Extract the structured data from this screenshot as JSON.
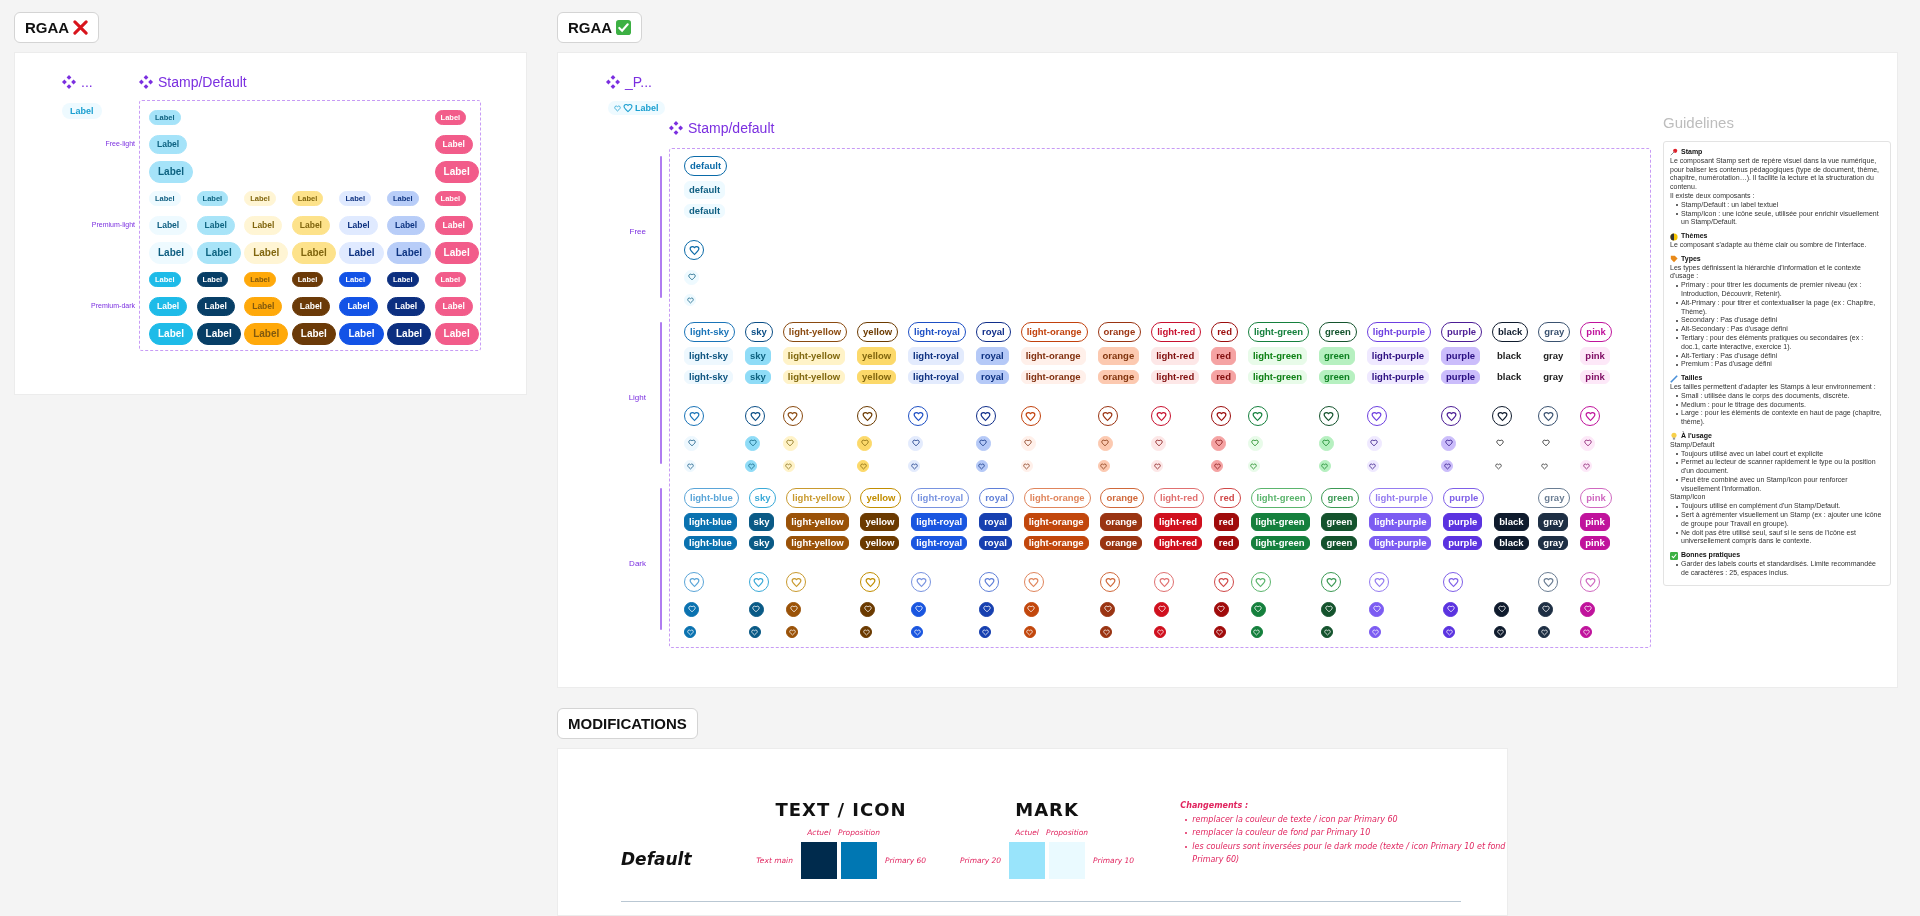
{
  "left": {
    "chip": {
      "text": "RGAA",
      "compliant": false
    },
    "component": {
      "name": "...",
      "pill": "Label"
    },
    "title": "Stamp/Default",
    "groups": [
      {
        "label": "Free-light",
        "rows": [
          {
            "kind": "small",
            "items": [
              {
                "text": "Label",
                "color": "#a5e3f9"
              },
              {
                "text": "Label",
                "color": "#f25c8a"
              }
            ]
          },
          {
            "kind": "medium",
            "items": [
              {
                "text": "Label",
                "color": "#a5e3f9"
              },
              {
                "text": "Label",
                "color": "#f25c8a"
              }
            ]
          },
          {
            "kind": "large",
            "items": [
              {
                "text": "Label",
                "color": "#a5e3f9"
              },
              {
                "text": "Label",
                "color": "#f25c8a"
              }
            ]
          }
        ]
      },
      {
        "label": "Premium-light",
        "rows": [
          {
            "kind": "small",
            "items": [
              {
                "text": "Label",
                "color": "#eefaff"
              },
              {
                "text": "Label",
                "color": "#a8e4f8"
              },
              {
                "text": "Label",
                "color": "#fff5d4"
              },
              {
                "text": "Label",
                "color": "#fde28a"
              },
              {
                "text": "Label",
                "color": "#e0eaff"
              },
              {
                "text": "Label",
                "color": "#b8cdf8"
              },
              {
                "text": "Label",
                "color": "#f25c8a"
              }
            ]
          },
          {
            "kind": "medium",
            "items": [
              {
                "text": "Label",
                "color": "#eefaff"
              },
              {
                "text": "Label",
                "color": "#a8e4f8"
              },
              {
                "text": "Label",
                "color": "#fff5d4"
              },
              {
                "text": "Label",
                "color": "#fde28a"
              },
              {
                "text": "Label",
                "color": "#e0eaff"
              },
              {
                "text": "Label",
                "color": "#b8cdf8"
              },
              {
                "text": "Label",
                "color": "#f25c8a"
              }
            ]
          },
          {
            "kind": "large",
            "items": [
              {
                "text": "Label",
                "color": "#eefaff"
              },
              {
                "text": "Label",
                "color": "#a8e4f8"
              },
              {
                "text": "Label",
                "color": "#fff5d4"
              },
              {
                "text": "Label",
                "color": "#fde28a"
              },
              {
                "text": "Label",
                "color": "#e0eaff"
              },
              {
                "text": "Label",
                "color": "#b8cdf8"
              },
              {
                "text": "Label",
                "color": "#f25c8a"
              }
            ]
          }
        ]
      },
      {
        "label": "Premium-dark",
        "rows": [
          {
            "kind": "small",
            "items": [
              {
                "text": "Label",
                "color": "#1ebbe8"
              },
              {
                "text": "Label",
                "color": "#073e66"
              },
              {
                "text": "Label",
                "color": "#ffa90a"
              },
              {
                "text": "Label",
                "color": "#6b3a08"
              },
              {
                "text": "Label",
                "color": "#1353e6"
              },
              {
                "text": "Label",
                "color": "#0c2f80"
              },
              {
                "text": "Label",
                "color": "#f25c8a"
              }
            ]
          },
          {
            "kind": "medium",
            "items": [
              {
                "text": "Label",
                "color": "#1ebbe8"
              },
              {
                "text": "Label",
                "color": "#073e66"
              },
              {
                "text": "Label",
                "color": "#ffa90a"
              },
              {
                "text": "Label",
                "color": "#6b3a08"
              },
              {
                "text": "Label",
                "color": "#1353e6"
              },
              {
                "text": "Label",
                "color": "#0c2f80"
              },
              {
                "text": "Label",
                "color": "#f25c8a"
              }
            ]
          },
          {
            "kind": "large",
            "items": [
              {
                "text": "Label",
                "color": "#1ebbe8"
              },
              {
                "text": "Label",
                "color": "#073e66"
              },
              {
                "text": "Label",
                "color": "#ffa90a"
              },
              {
                "text": "Label",
                "color": "#6b3a08"
              },
              {
                "text": "Label",
                "color": "#1353e6"
              },
              {
                "text": "Label",
                "color": "#0c2f80"
              },
              {
                "text": "Label",
                "color": "#f25c8a"
              }
            ]
          }
        ]
      }
    ]
  },
  "right": {
    "chip": {
      "text": "RGAA",
      "compliant": true
    },
    "component": {
      "name": "_P...",
      "pill": "Label"
    },
    "title": "Stamp/default",
    "sections": [
      {
        "label": "Free",
        "rows": [
          {
            "kind": "outlined",
            "items": [
              {
                "text": "default",
                "color": "#0a6aa8"
              }
            ]
          },
          {
            "kind": "medium",
            "items": [
              {
                "text": "default",
                "color": "#eefaff"
              }
            ]
          },
          {
            "kind": "small",
            "items": [
              {
                "text": "default",
                "color": "#eefaff"
              }
            ]
          },
          {
            "kind": "ring",
            "items": [
              {
                "color": "#0a6aa8"
              }
            ]
          },
          {
            "kind": "disc",
            "items": [
              {
                "color": "#eefaff"
              }
            ]
          },
          {
            "kind": "minidisc",
            "items": [
              {
                "color": "#eefaff"
              }
            ]
          }
        ]
      },
      {
        "label": "Light",
        "rows": [
          {
            "kind": "outlined",
            "items": [
              {
                "text": "light-sky",
                "color": "#1a74b8"
              },
              {
                "text": "sky",
                "color": "#0a4e86"
              },
              {
                "text": "light-yellow",
                "color": "#8a4a10"
              },
              {
                "text": "yellow",
                "color": "#6b3a00"
              },
              {
                "text": "light-royal",
                "color": "#1d4fc4"
              },
              {
                "text": "royal",
                "color": "#102e8a"
              },
              {
                "text": "light-orange",
                "color": "#c2410c"
              },
              {
                "text": "orange",
                "color": "#9a3412"
              },
              {
                "text": "light-red",
                "color": "#c8102e"
              },
              {
                "text": "red",
                "color": "#9b0c0c"
              },
              {
                "text": "light-green",
                "color": "#15803d"
              },
              {
                "text": "green",
                "color": "#14532d"
              },
              {
                "text": "light-purple",
                "color": "#6d3fe0"
              },
              {
                "text": "purple",
                "color": "#4c1d95"
              },
              {
                "text": "black",
                "color": "#0f1b2d"
              },
              {
                "text": "gray",
                "color": "#3a5270"
              },
              {
                "text": "pink",
                "color": "#c0139c"
              }
            ]
          },
          {
            "kind": "medium",
            "items": [
              {
                "text": "light-sky",
                "color": "#eef8fe"
              },
              {
                "text": "sky",
                "color": "#8fdcf7"
              },
              {
                "text": "light-yellow",
                "color": "#fff3c8"
              },
              {
                "text": "yellow",
                "color": "#fcd96a"
              },
              {
                "text": "light-royal",
                "color": "#e3ebfd"
              },
              {
                "text": "royal",
                "color": "#b5c9f7"
              },
              {
                "text": "light-orange",
                "color": "#fff0ea"
              },
              {
                "text": "orange",
                "color": "#fcc9b0"
              },
              {
                "text": "light-red",
                "color": "#fde7e7"
              },
              {
                "text": "red",
                "color": "#f5a3a3"
              },
              {
                "text": "light-green",
                "color": "#e8fbe9"
              },
              {
                "text": "green",
                "color": "#b6f0c0"
              },
              {
                "text": "light-purple",
                "color": "#efe9ff"
              },
              {
                "text": "purple",
                "color": "#cbbdfb"
              },
              {
                "text": "black",
                "color": "#ffffff"
              },
              {
                "text": "gray",
                "color": "#ffffff"
              },
              {
                "text": "pink",
                "color": "#fde8f8"
              }
            ]
          },
          {
            "kind": "small",
            "items": [
              {
                "text": "light-sky",
                "color": "#eef8fe"
              },
              {
                "text": "sky",
                "color": "#8fdcf7"
              },
              {
                "text": "light-yellow",
                "color": "#fff3c8"
              },
              {
                "text": "yellow",
                "color": "#fcd96a"
              },
              {
                "text": "light-royal",
                "color": "#e3ebfd"
              },
              {
                "text": "royal",
                "color": "#b5c9f7"
              },
              {
                "text": "light-orange",
                "color": "#fff0ea"
              },
              {
                "text": "orange",
                "color": "#fcc9b0"
              },
              {
                "text": "light-red",
                "color": "#fde7e7"
              },
              {
                "text": "red",
                "color": "#f5a3a3"
              },
              {
                "text": "light-green",
                "color": "#e8fbe9"
              },
              {
                "text": "green",
                "color": "#b6f0c0"
              },
              {
                "text": "light-purple",
                "color": "#efe9ff"
              },
              {
                "text": "purple",
                "color": "#cbbdfb"
              },
              {
                "text": "black",
                "color": "#ffffff"
              },
              {
                "text": "gray",
                "color": "#ffffff"
              },
              {
                "text": "pink",
                "color": "#fde8f8"
              }
            ]
          },
          {
            "kind": "ring",
            "items": [
              {
                "color": "#1a74b8"
              },
              {
                "color": "#0a4e86"
              },
              {
                "color": "#8a4a10"
              },
              {
                "color": "#6b3a00"
              },
              {
                "color": "#1d4fc4"
              },
              {
                "color": "#102e8a"
              },
              {
                "color": "#c2410c"
              },
              {
                "color": "#9a3412"
              },
              {
                "color": "#c8102e"
              },
              {
                "color": "#9b0c0c"
              },
              {
                "color": "#15803d"
              },
              {
                "color": "#14532d"
              },
              {
                "color": "#6d3fe0"
              },
              {
                "color": "#4c1d95"
              },
              {
                "color": "#0f1b2d"
              },
              {
                "color": "#3a5270"
              },
              {
                "color": "#c0139c"
              }
            ]
          },
          {
            "kind": "disc",
            "items": [
              {
                "color": "#eef8fe"
              },
              {
                "color": "#8fdcf7"
              },
              {
                "color": "#fff3c8"
              },
              {
                "color": "#fcd96a"
              },
              {
                "color": "#e3ebfd"
              },
              {
                "color": "#b5c9f7"
              },
              {
                "color": "#fff0ea"
              },
              {
                "color": "#fcc9b0"
              },
              {
                "color": "#fde7e7"
              },
              {
                "color": "#f5a3a3"
              },
              {
                "color": "#e8fbe9"
              },
              {
                "color": "#b6f0c0"
              },
              {
                "color": "#efe9ff"
              },
              {
                "color": "#cbbdfb"
              },
              {
                "color": "#ffffff"
              },
              {
                "color": "#ffffff"
              },
              {
                "color": "#fde8f8"
              }
            ]
          },
          {
            "kind": "minidisc",
            "items": [
              {
                "color": "#eef8fe"
              },
              {
                "color": "#8fdcf7"
              },
              {
                "color": "#fff3c8"
              },
              {
                "color": "#fcd96a"
              },
              {
                "color": "#e3ebfd"
              },
              {
                "color": "#b5c9f7"
              },
              {
                "color": "#fff0ea"
              },
              {
                "color": "#fcc9b0"
              },
              {
                "color": "#fde7e7"
              },
              {
                "color": "#f5a3a3"
              },
              {
                "color": "#e8fbe9"
              },
              {
                "color": "#b6f0c0"
              },
              {
                "color": "#efe9ff"
              },
              {
                "color": "#cbbdfb"
              },
              {
                "color": "#ffffff"
              },
              {
                "color": "#ffffff"
              },
              {
                "color": "#fde8f8"
              }
            ]
          }
        ]
      },
      {
        "label": "Dark",
        "rows": [
          {
            "kind": "outlined",
            "items": [
              {
                "text": "light-blue",
                "color": "#5aa5d8"
              },
              {
                "text": "sky",
                "color": "#3aaad8"
              },
              {
                "text": "light-yellow",
                "color": "#c99a2e"
              },
              {
                "text": "yellow",
                "color": "#c28e00"
              },
              {
                "text": "light-royal",
                "color": "#7893e0"
              },
              {
                "text": "royal",
                "color": "#5f7fd8"
              },
              {
                "text": "light-orange",
                "color": "#e0855c"
              },
              {
                "text": "orange",
                "color": "#d0683a"
              },
              {
                "text": "light-red",
                "color": "#e07070"
              },
              {
                "text": "red",
                "color": "#d04848"
              },
              {
                "text": "light-green",
                "color": "#5bb56d"
              },
              {
                "text": "green",
                "color": "#3c9a55"
              },
              {
                "text": "light-purple",
                "color": "#957cf0"
              },
              {
                "text": "purple",
                "color": "#7f5fe8"
              },
              {
                "text": "gray",
                "color": "#6a7d93",
                "gap_before": true
              },
              {
                "text": "pink",
                "color": "#d068c0"
              }
            ]
          },
          {
            "kind": "medium",
            "items": [
              {
                "text": "light-blue",
                "color": "#0a72b0"
              },
              {
                "text": "sky",
                "color": "#0a5a86"
              },
              {
                "text": "light-yellow",
                "color": "#9a5208"
              },
              {
                "text": "yellow",
                "color": "#6b3a00"
              },
              {
                "text": "light-royal",
                "color": "#1a56e0"
              },
              {
                "text": "royal",
                "color": "#1740b0"
              },
              {
                "text": "light-orange",
                "color": "#c2470c"
              },
              {
                "text": "orange",
                "color": "#9a3412"
              },
              {
                "text": "light-red",
                "color": "#d0101e"
              },
              {
                "text": "red",
                "color": "#a00b0b"
              },
              {
                "text": "light-green",
                "color": "#15803d"
              },
              {
                "text": "green",
                "color": "#14532d"
              },
              {
                "text": "light-purple",
                "color": "#7c5cf2"
              },
              {
                "text": "purple",
                "color": "#5b33e0"
              },
              {
                "text": "black",
                "color": "#0f1b2d"
              },
              {
                "text": "gray",
                "color": "#1e2f44"
              },
              {
                "text": "pink",
                "color": "#c0139c"
              }
            ]
          },
          {
            "kind": "small",
            "items": [
              {
                "text": "light-blue",
                "color": "#0a72b0"
              },
              {
                "text": "sky",
                "color": "#0a5a86"
              },
              {
                "text": "light-yellow",
                "color": "#9a5208"
              },
              {
                "text": "yellow",
                "color": "#6b3a00"
              },
              {
                "text": "light-royal",
                "color": "#1a56e0"
              },
              {
                "text": "royal",
                "color": "#1740b0"
              },
              {
                "text": "light-orange",
                "color": "#c2470c"
              },
              {
                "text": "orange",
                "color": "#9a3412"
              },
              {
                "text": "light-red",
                "color": "#d0101e"
              },
              {
                "text": "red",
                "color": "#a00b0b"
              },
              {
                "text": "light-green",
                "color": "#15803d"
              },
              {
                "text": "green",
                "color": "#14532d"
              },
              {
                "text": "light-purple",
                "color": "#7c5cf2"
              },
              {
                "text": "purple",
                "color": "#5b33e0"
              },
              {
                "text": "black",
                "color": "#0f1b2d"
              },
              {
                "text": "gray",
                "color": "#1e2f44"
              },
              {
                "text": "pink",
                "color": "#c0139c"
              }
            ]
          },
          {
            "kind": "ring",
            "items": [
              {
                "color": "#5aa5d8"
              },
              {
                "color": "#3aaad8"
              },
              {
                "color": "#c99a2e"
              },
              {
                "color": "#c28e00"
              },
              {
                "color": "#7893e0"
              },
              {
                "color": "#5f7fd8"
              },
              {
                "color": "#e0855c"
              },
              {
                "color": "#d0683a"
              },
              {
                "color": "#e07070"
              },
              {
                "color": "#d04848"
              },
              {
                "color": "#5bb56d"
              },
              {
                "color": "#3c9a55"
              },
              {
                "color": "#957cf0"
              },
              {
                "color": "#7f5fe8"
              },
              {
                "color": "#6a7d93",
                "gap_before": true
              },
              {
                "color": "#d068c0"
              }
            ]
          },
          {
            "kind": "disc",
            "items": [
              {
                "color": "#0a72b0"
              },
              {
                "color": "#0a5a86"
              },
              {
                "color": "#9a5208"
              },
              {
                "color": "#6b3a00"
              },
              {
                "color": "#1a56e0"
              },
              {
                "color": "#1740b0"
              },
              {
                "color": "#c2470c"
              },
              {
                "color": "#9a3412"
              },
              {
                "color": "#d0101e"
              },
              {
                "color": "#a00b0b"
              },
              {
                "color": "#15803d"
              },
              {
                "color": "#14532d"
              },
              {
                "color": "#7c5cf2"
              },
              {
                "color": "#5b33e0"
              },
              {
                "color": "#0f1b2d"
              },
              {
                "color": "#1e2f44"
              },
              {
                "color": "#c0139c"
              }
            ]
          },
          {
            "kind": "minidisc",
            "items": [
              {
                "color": "#0a72b0"
              },
              {
                "color": "#0a5a86"
              },
              {
                "color": "#9a5208"
              },
              {
                "color": "#6b3a00"
              },
              {
                "color": "#1a56e0"
              },
              {
                "color": "#1740b0"
              },
              {
                "color": "#c2470c"
              },
              {
                "color": "#9a3412"
              },
              {
                "color": "#d0101e"
              },
              {
                "color": "#a00b0b"
              },
              {
                "color": "#15803d"
              },
              {
                "color": "#14532d"
              },
              {
                "color": "#7c5cf2"
              },
              {
                "color": "#5b33e0"
              },
              {
                "color": "#0f1b2d"
              },
              {
                "color": "#1e2f44"
              },
              {
                "color": "#c0139c"
              }
            ]
          }
        ]
      }
    ],
    "guidelines": {
      "title": "Guidelines",
      "sections": [
        {
          "title": "Stamp",
          "blocks": [
            {
              "kind": "text",
              "text": "Le composant Stamp sert de repère visuel dans la vue numérique, pour baliser les contenus pédagogiques (type de document, thème, chapitre, numérotation…). Il facilite la lecture et la structuration du contenu."
            },
            {
              "kind": "text",
              "text": "Il existe deux composants :"
            },
            {
              "kind": "list",
              "items": [
                "Stamp/Default : un label textuel",
                "Stamp/Icon : une icône seule, utilisée pour enrichir visuellement un Stamp/Default."
              ]
            }
          ]
        },
        {
          "title": "Thèmes",
          "blocks": [
            {
              "kind": "text",
              "text": "Le composant s'adapte au thème clair ou sombre de l'interface."
            }
          ]
        },
        {
          "title": "Types",
          "blocks": [
            {
              "kind": "text",
              "text": "Les types définissent la hiérarchie d'information et le contexte d'usage :"
            },
            {
              "kind": "list",
              "items": [
                "Primary : pour titrer les documents de premier niveau (ex : Introduction, Découvrir, Retenir).",
                "Alt-Primary : pour titrer et contextualiser la page (ex : Chapitre, Thème).",
                "Secondary : Pas d'usage défini",
                "Alt-Secondary : Pas d'usage défini",
                "Tertiary : pour des éléments pratiques ou secondaires (ex : doc.1, carte interactive, exercice 1).",
                "Alt-Tertiary : Pas d'usage défini",
                "Premium : Pas d'usage défini"
              ]
            }
          ]
        },
        {
          "title": "Tailles",
          "blocks": [
            {
              "kind": "text",
              "text": "Les tailles permettent d'adapter les Stamps à leur environnement :"
            },
            {
              "kind": "list",
              "items": [
                "Small : utilisée dans le corps des documents, discrète.",
                "Medium : pour le titrage des documents.",
                "Large : pour les éléments de contexte en haut de page (chapitre, thème)."
              ]
            }
          ]
        },
        {
          "title": "À l'usage",
          "blocks": [
            {
              "kind": "text",
              "text": "Stamp/Default"
            },
            {
              "kind": "list",
              "items": [
                "Toujours utilisé avec un label court et explicite",
                "Permet au lecteur de scanner rapidement le type ou la position d'un document.",
                "Peut être combiné avec un Stamp/Icon pour renforcer visuellement l'information."
              ]
            },
            {
              "kind": "text",
              "text": "Stamp/Icon"
            },
            {
              "kind": "list",
              "items": [
                "Toujours utilisé en complément d'un Stamp/Default.",
                "Sert à agrémenter visuellement un Stamp (ex : ajouter une icône de groupe pour Travail en groupe).",
                "Ne doit pas être utilisé seul, sauf si le sens de l'icône est universellement compris dans le contexte."
              ]
            }
          ]
        },
        {
          "title": "Bonnes pratiques",
          "blocks": [
            {
              "kind": "list",
              "items": [
                "Garder des labels courts et standardisés. Limite recommandée de caractères : 25, espaces inclus."
              ]
            }
          ]
        }
      ]
    }
  },
  "modifications": {
    "chip": "MODIFICATIONS",
    "row_label": "Default",
    "groups": [
      {
        "title": "TEXT / ICON",
        "current_name": "Text main",
        "proposal_name": "Primary 60",
        "swatches": [
          {
            "label": "Actuel",
            "color": "#002b4d"
          },
          {
            "label": "Proposition",
            "color": "#0077b3"
          }
        ]
      },
      {
        "title": "MARK",
        "current_name": "Primary 20",
        "proposal_name": "Primary 10",
        "swatches": [
          {
            "label": "Actuel",
            "color": "#99e4fb"
          },
          {
            "label": "Proposition",
            "color": "#eafaff"
          }
        ]
      }
    ],
    "changes": {
      "title": "Changements :",
      "items": [
        "remplacer la couleur de texte / icon par Primary 60",
        "remplacer la couleur de fond par Primary 10",
        "les couleurs sont inversées pour le dark mode (texte / icon Primary 10 et fond Primary 60)"
      ]
    }
  }
}
